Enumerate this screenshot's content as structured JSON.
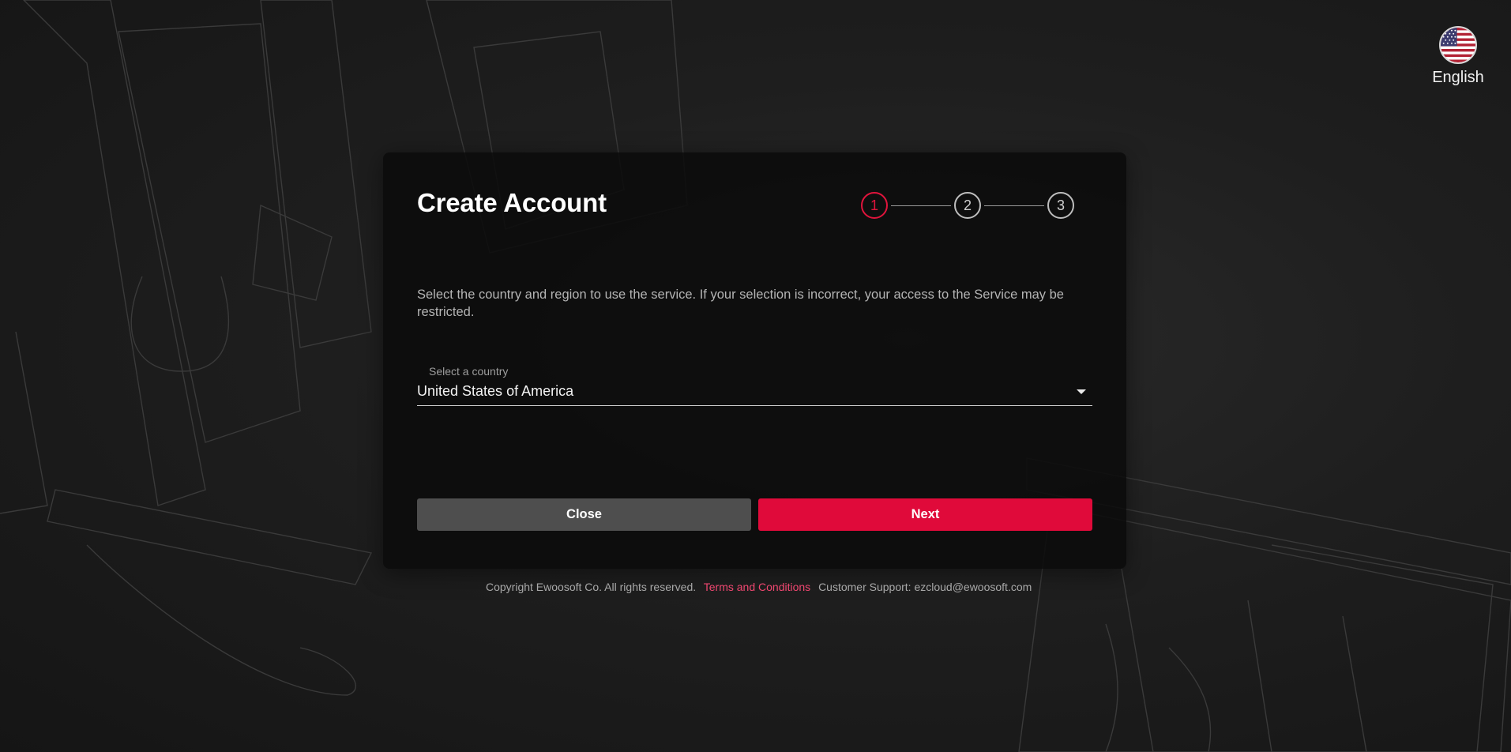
{
  "language": {
    "label": "English",
    "flag_icon": "us-flag-icon"
  },
  "card": {
    "title": "Create Account",
    "steps": [
      "1",
      "2",
      "3"
    ],
    "active_step": 1,
    "description": "Select the country and region to use the service. If your selection is incorrect, your access to the Service may be restricted.",
    "country_select": {
      "label": "Select a country",
      "value": "United States of America"
    },
    "close_label": "Close",
    "next_label": "Next"
  },
  "footer": {
    "copyright": "Copyright Ewoosoft Co. All rights reserved.",
    "terms_link": "Terms and Conditions",
    "support": "Customer Support: ezcloud@ewoosoft.com"
  },
  "colors": {
    "accent": "#e00a3a",
    "background": "#1e1e1e",
    "card": "#0a0a0a",
    "close_button": "#4e4e4e"
  }
}
